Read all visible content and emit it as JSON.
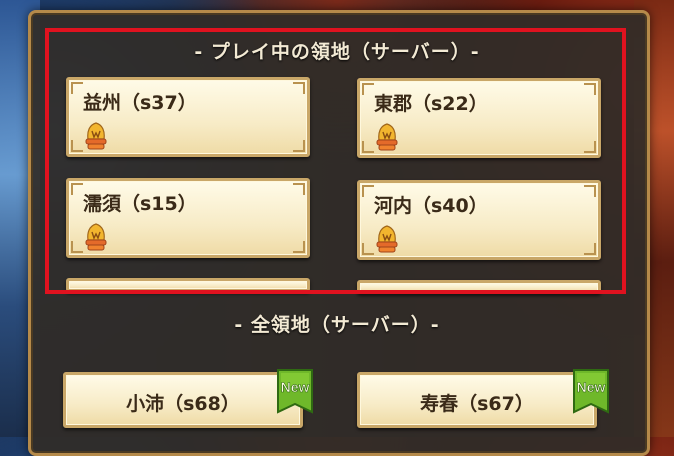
{
  "playing_section": {
    "title": "- プレイ中の領地（サーバー）-",
    "servers": [
      {
        "label": "益州（s37）",
        "icon": "helmet-icon"
      },
      {
        "label": "東郡（s22）",
        "icon": "helmet-icon"
      },
      {
        "label": "濡須（s15）",
        "icon": "helmet-icon"
      },
      {
        "label": "河内（s40）",
        "icon": "helmet-icon"
      }
    ]
  },
  "all_section": {
    "title": "- 全領地（サーバー）-",
    "servers": [
      {
        "label": "小沛（s68）",
        "badge": "New"
      },
      {
        "label": "寿春（s67）",
        "badge": "New"
      }
    ]
  },
  "colors": {
    "highlight": "#e0121f",
    "badge_green": "#6fb82a",
    "card_bg": "#f7ebc6",
    "panel_bg": "#302c28"
  }
}
